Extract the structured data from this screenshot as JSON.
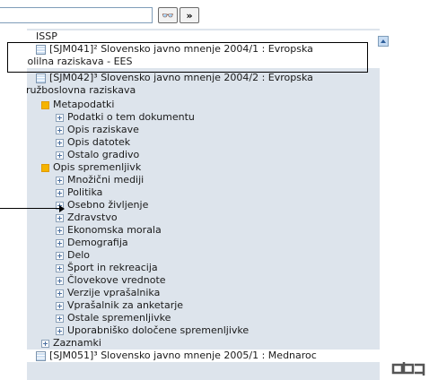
{
  "search": {
    "value": "",
    "find_icon": "binoculars-icon",
    "next_icon": "double-chevron-right-icon",
    "find_glyph": "👓",
    "next_glyph": "»"
  },
  "tree": {
    "top_label": "ISSP",
    "sjm041_line1": "[SJM041]² Slovensko javno mnenje 2004/1 : Evropska",
    "sjm041_line2": "volilna raziskava - EES",
    "sjm042_line1": "[SJM042]³ Slovensko javno mnenje 2004/2 : Evropska",
    "sjm042_line2": "družboslovna raziskava",
    "metapodatki": "Metapodatki",
    "meta_items": [
      "Podatki o tem dokumentu",
      "Opis raziskave",
      "Opis datotek",
      "Ostalo gradivo"
    ],
    "opis_spremenljivk": "Opis spremenljivk",
    "var_items": [
      "Množični mediji",
      "Politika",
      "Osebno življenje",
      "Zdravstvo",
      "Ekonomska morala",
      "Demografija",
      "Delo",
      "Šport in rekreacija",
      "Človekove vrednote",
      "Verzije vprašalnika",
      "Vprašalnik za anketarje",
      "Ostale spremenljivke",
      "Uporabniško določene spremenljivke"
    ],
    "zaznamki": "Zaznamki",
    "sjm051": "[SJM051]³ Slovensko javno mnenje 2005/1 : Mednaroc"
  },
  "colors": {
    "panel_bg": "#dde4ec",
    "folder": "#f5b400"
  }
}
